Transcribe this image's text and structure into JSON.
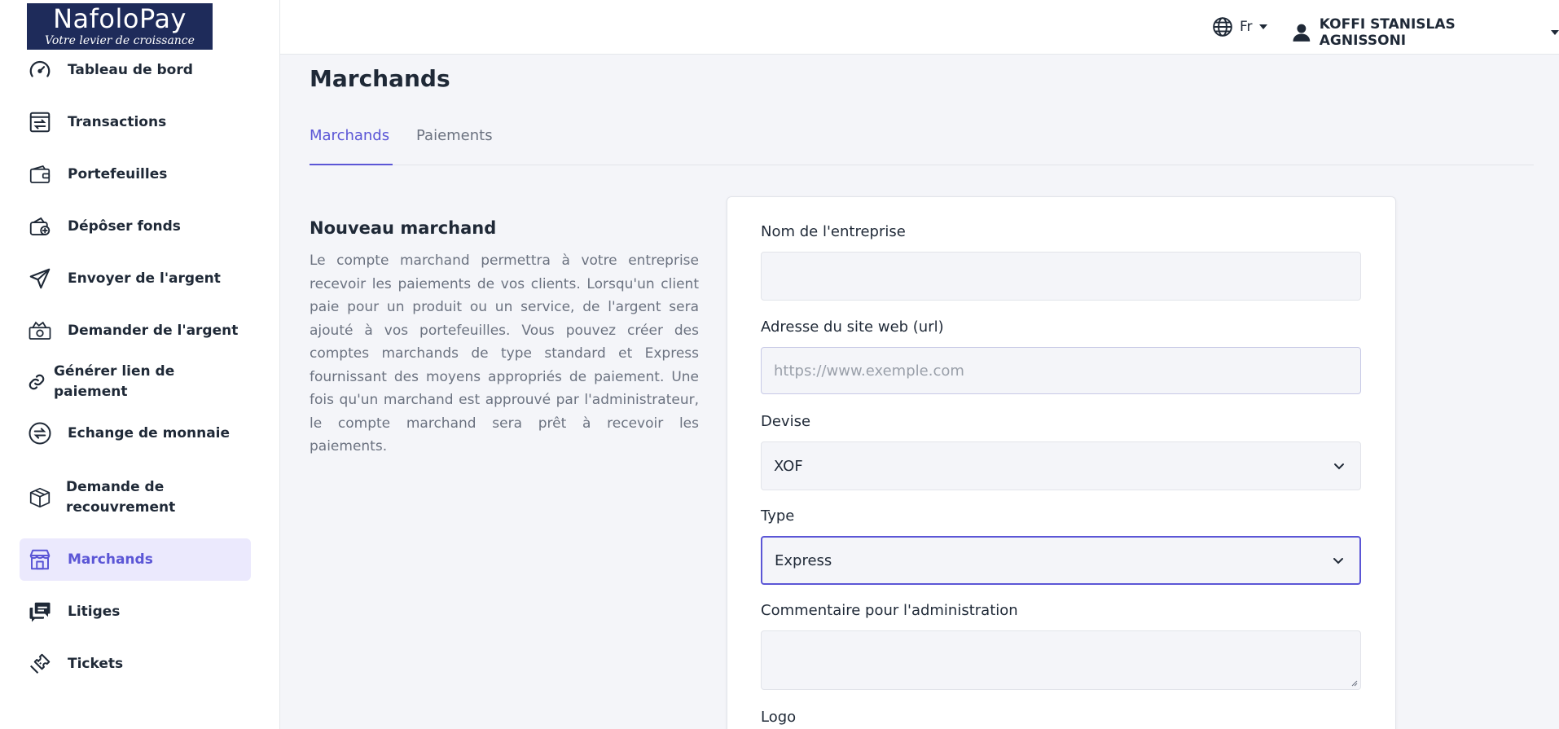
{
  "brand": {
    "name": "NafoloPay",
    "tagline": "Votre levier de croissance",
    "bg_color": "#1e2b5a"
  },
  "sidebar": {
    "items": [
      {
        "label": "Tableau de bord",
        "icon": "speedometer-icon"
      },
      {
        "label": "Transactions",
        "icon": "transactions-icon"
      },
      {
        "label": "Portefeuilles",
        "icon": "wallet-icon"
      },
      {
        "label": "Dépôser fonds",
        "icon": "deposit-wallet-icon"
      },
      {
        "label": "Envoyer de l'argent",
        "icon": "send-icon"
      },
      {
        "label": "Demander de l'argent",
        "icon": "money-request-icon"
      },
      {
        "label": "Générer lien de paiement",
        "icon": "link-icon"
      },
      {
        "label": "Echange de monnaie",
        "icon": "exchange-icon"
      },
      {
        "label": "Demande de recouvrement",
        "icon": "box-icon"
      },
      {
        "label": "Marchands",
        "icon": "store-icon",
        "active": true
      },
      {
        "label": "Litiges",
        "icon": "chat-icon"
      },
      {
        "label": "Tickets",
        "icon": "ticket-icon"
      }
    ]
  },
  "topbar": {
    "language": "Fr",
    "user_name": "KOFFI STANISLAS AGNISSONI"
  },
  "main": {
    "title": "Marchands",
    "tabs": [
      {
        "label": "Marchands",
        "active": true
      },
      {
        "label": "Paiements",
        "active": false
      }
    ],
    "section_title": "Nouveau marchand",
    "section_description": "Le compte marchand permettra à votre entreprise recevoir les paiements de vos clients. Lorsqu'un client paie pour un produit ou un service, de l'argent sera ajouté à vos portefeuilles. Vous pouvez créer des comptes marchands de type standard et Express fournissant des moyens appropriés de paiement. Une fois qu'un marchand est approuvé par l'administrateur, le compte marchand sera prêt à recevoir les paiements."
  },
  "form": {
    "company_name": {
      "label": "Nom de l'entreprise",
      "value": ""
    },
    "website": {
      "label": "Adresse du site web (url)",
      "placeholder": "https://www.exemple.com"
    },
    "currency": {
      "label": "Devise",
      "value": "XOF"
    },
    "type": {
      "label": "Type",
      "value": "Express"
    },
    "comment": {
      "label": "Commentaire pour l'administration",
      "value": ""
    },
    "logo": {
      "label": "Logo"
    }
  },
  "colors": {
    "accent": "#5b56d6",
    "active_bg": "#ebe9fd",
    "page_bg": "#f4f5f9"
  }
}
